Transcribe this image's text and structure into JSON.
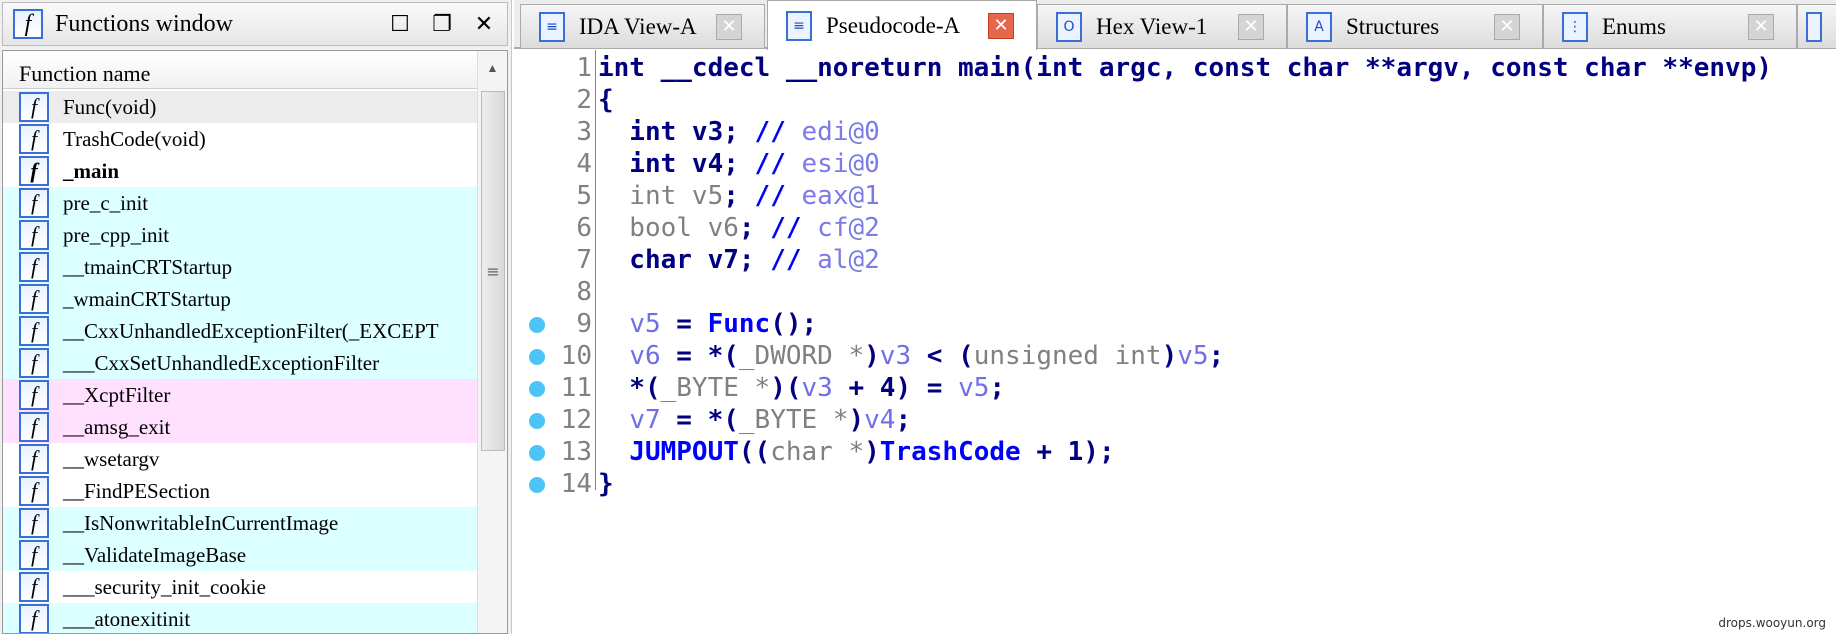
{
  "functions_window": {
    "title": "Functions window",
    "column_header": "Function name",
    "functions": [
      {
        "name": "Func(void)",
        "style": "sel"
      },
      {
        "name": "TrashCode(void)",
        "style": "white"
      },
      {
        "name": "_main",
        "style": "white bold"
      },
      {
        "name": "pre_c_init",
        "style": "cyan"
      },
      {
        "name": "pre_cpp_init",
        "style": "cyan"
      },
      {
        "name": "__tmainCRTStartup",
        "style": "cyan"
      },
      {
        "name": "_wmainCRTStartup",
        "style": "cyan"
      },
      {
        "name": "__CxxUnhandledExceptionFilter(_EXCEPT",
        "style": "cyan"
      },
      {
        "name": "___CxxSetUnhandledExceptionFilter",
        "style": "cyan"
      },
      {
        "name": "__XcptFilter",
        "style": "pink"
      },
      {
        "name": "__amsg_exit",
        "style": "pink"
      },
      {
        "name": "__wsetargv",
        "style": "white"
      },
      {
        "name": "__FindPESection",
        "style": "white"
      },
      {
        "name": "__IsNonwritableInCurrentImage",
        "style": "cyan"
      },
      {
        "name": "__ValidateImageBase",
        "style": "cyan"
      },
      {
        "name": "___security_init_cookie",
        "style": "white"
      },
      {
        "name": "___atonexitinit",
        "style": "cyan"
      }
    ]
  },
  "tabs": [
    {
      "label": "IDA View-A",
      "icon": "≡",
      "active": false
    },
    {
      "label": "Pseudocode-A",
      "icon": "≡",
      "active": true
    },
    {
      "label": "Hex View-1",
      "icon": "O",
      "active": false
    },
    {
      "label": "Structures",
      "icon": "A",
      "active": false
    },
    {
      "label": "Enums",
      "icon": "⋮",
      "active": false
    }
  ],
  "code": [
    {
      "n": "1",
      "bp": false,
      "t": [
        [
          "int __cdecl __noreturn main(int argc, const char **argv, const char **envp)",
          "k"
        ]
      ]
    },
    {
      "n": "2",
      "bp": false,
      "t": [
        [
          "{",
          "k"
        ]
      ]
    },
    {
      "n": "3",
      "bp": false,
      "t": [
        [
          "  int v3; ",
          "k"
        ],
        [
          "// ",
          "c"
        ],
        [
          "edi@0",
          "cm"
        ]
      ]
    },
    {
      "n": "4",
      "bp": false,
      "t": [
        [
          "  int v4; ",
          "k"
        ],
        [
          "// ",
          "c"
        ],
        [
          "esi@0",
          "cm"
        ]
      ]
    },
    {
      "n": "5",
      "bp": false,
      "t": [
        [
          "  int v5",
          "g"
        ],
        [
          "; ",
          "k"
        ],
        [
          "// ",
          "c"
        ],
        [
          "eax@1",
          "cm"
        ]
      ]
    },
    {
      "n": "6",
      "bp": false,
      "t": [
        [
          "  bool v6",
          "g"
        ],
        [
          "; ",
          "k"
        ],
        [
          "// ",
          "c"
        ],
        [
          "cf@2",
          "cm"
        ]
      ]
    },
    {
      "n": "7",
      "bp": false,
      "t": [
        [
          "  char v7; ",
          "k"
        ],
        [
          "// ",
          "c"
        ],
        [
          "al@2",
          "cm"
        ]
      ]
    },
    {
      "n": "8",
      "bp": false,
      "t": []
    },
    {
      "n": "9",
      "bp": true,
      "t": [
        [
          "  ",
          "k"
        ],
        [
          "v5",
          "v"
        ],
        [
          " = ",
          "k"
        ],
        [
          "Func",
          "f"
        ],
        [
          "();",
          "k"
        ]
      ]
    },
    {
      "n": "10",
      "bp": true,
      "t": [
        [
          "  ",
          "k"
        ],
        [
          "v6",
          "v"
        ],
        [
          " = *(",
          "k"
        ],
        [
          "_DWORD *",
          "g"
        ],
        [
          ")",
          "k"
        ],
        [
          "v3",
          "v"
        ],
        [
          " < (",
          "k"
        ],
        [
          "unsigned int",
          "g"
        ],
        [
          ")",
          "k"
        ],
        [
          "v5",
          "v"
        ],
        [
          ";",
          "k"
        ]
      ]
    },
    {
      "n": "11",
      "bp": true,
      "t": [
        [
          "  *(",
          "k"
        ],
        [
          "_BYTE *",
          "g"
        ],
        [
          ")(",
          "k"
        ],
        [
          "v3",
          "v"
        ],
        [
          " + 4) = ",
          "k"
        ],
        [
          "v5",
          "v"
        ],
        [
          ";",
          "k"
        ]
      ]
    },
    {
      "n": "12",
      "bp": true,
      "t": [
        [
          "  ",
          "k"
        ],
        [
          "v7",
          "v"
        ],
        [
          " = *(",
          "k"
        ],
        [
          "_BYTE *",
          "g"
        ],
        [
          ")",
          "k"
        ],
        [
          "v4",
          "v"
        ],
        [
          ";",
          "k"
        ]
      ]
    },
    {
      "n": "13",
      "bp": true,
      "t": [
        [
          "  ",
          "k"
        ],
        [
          "JUMPOUT",
          "f"
        ],
        [
          "((",
          "k"
        ],
        [
          "char *",
          "g"
        ],
        [
          ")",
          "k"
        ],
        [
          "TrashCode",
          "f"
        ],
        [
          " + 1);",
          "k"
        ]
      ]
    },
    {
      "n": "14",
      "bp": true,
      "t": [
        [
          "}",
          "k"
        ]
      ]
    }
  ],
  "watermark": "drops.wooyun.org"
}
